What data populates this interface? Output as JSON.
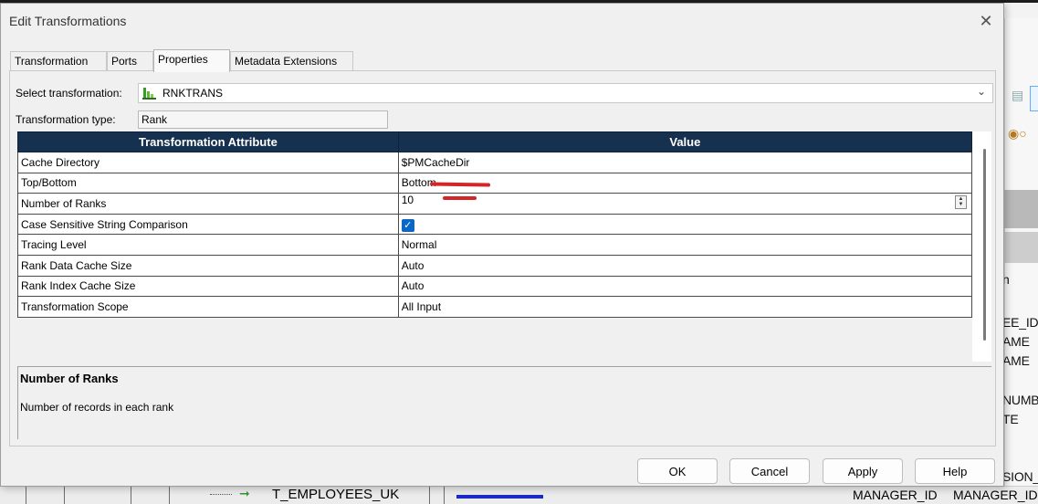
{
  "dialog": {
    "title": "Edit Transformations",
    "close_icon": "close-icon"
  },
  "tabs": [
    {
      "label": "Transformation",
      "active": false
    },
    {
      "label": "Ports",
      "active": false
    },
    {
      "label": "Properties",
      "active": true
    },
    {
      "label": "Metadata Extensions",
      "active": false
    }
  ],
  "select_transformation": {
    "label": "Select transformation:",
    "value": "RNKTRANS",
    "icon": "rank-transformation-icon"
  },
  "transformation_type": {
    "label": "Transformation type:",
    "value": "Rank"
  },
  "grid": {
    "headers": [
      "Transformation Attribute",
      "Value"
    ],
    "rows": [
      {
        "attribute": "Cache Directory",
        "value": "$PMCacheDir"
      },
      {
        "attribute": "Top/Bottom",
        "value": "Bottom"
      },
      {
        "attribute": "Number of Ranks",
        "value": "10"
      },
      {
        "attribute": "Case Sensitive String Comparison",
        "value": "",
        "checked": true
      },
      {
        "attribute": "Tracing Level",
        "value": "Normal"
      },
      {
        "attribute": "Rank Data Cache Size",
        "value": "Auto"
      },
      {
        "attribute": "Rank Index Cache Size",
        "value": "Auto"
      },
      {
        "attribute": "Transformation Scope",
        "value": "All Input"
      }
    ]
  },
  "help": {
    "title": "Number of Ranks",
    "text": "Number of records in each rank"
  },
  "buttons": {
    "ok": "OK",
    "cancel": "Cancel",
    "apply": "Apply",
    "help": "Help"
  },
  "background": {
    "side_texts": [
      "n",
      "EE_ID",
      "AME",
      "AME",
      "NUMB",
      "TE",
      "SION_"
    ],
    "tree_label": "T_EMPLOYEES_UK",
    "manager_col1": "MANAGER_ID",
    "manager_col2": "MANAGER_ID"
  },
  "colors": {
    "header_bg": "#16304f",
    "checkbox": "#0b67c5",
    "annotation_red": "#d42626"
  }
}
